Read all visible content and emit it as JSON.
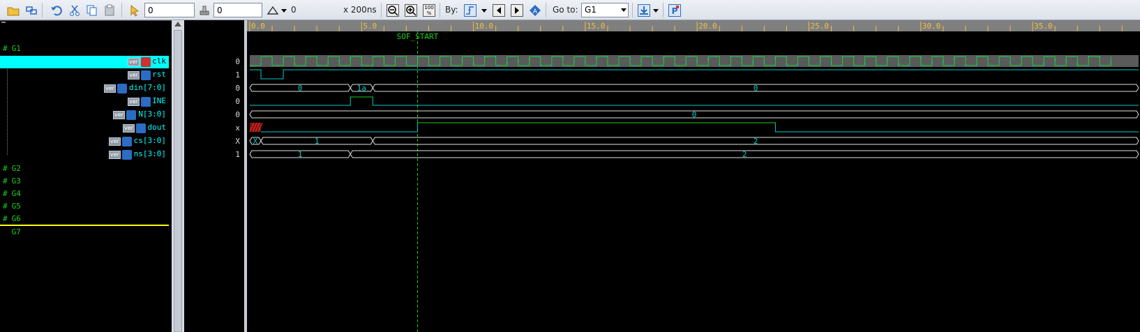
{
  "toolbar": {
    "field1_value": "0",
    "field2_value": "0",
    "delta_value": "0",
    "scale_text": "x 200ns",
    "zoom_fit_text": "100 %",
    "by_label": "By:",
    "goto_label": "Go to:",
    "goto_selected": "G1"
  },
  "groups": [
    "G1",
    "G2",
    "G3",
    "G4",
    "G5",
    "G6",
    "G7"
  ],
  "signals": [
    {
      "name": "clk",
      "ver": "ver",
      "value": "0",
      "selected": true
    },
    {
      "name": "rst",
      "ver": "ver",
      "value": "1"
    },
    {
      "name": "din[7:0]",
      "ver": "ver",
      "value": "0"
    },
    {
      "name": "INE",
      "ver": "ver",
      "value": "0"
    },
    {
      "name": "N[3:0]",
      "ver": "ver",
      "value": "0"
    },
    {
      "name": "dout",
      "ver": "ver",
      "value": "x"
    },
    {
      "name": "cs[3:0]",
      "ver": "ver",
      "value": "X"
    },
    {
      "name": "ns[3:0]",
      "ver": "ver",
      "value": "1"
    }
  ],
  "timeline": {
    "ticks": [
      "0.0",
      "5.0",
      "10.0",
      "15.0",
      "20.0",
      "25.0",
      "30.0",
      "35.0"
    ],
    "tick_values": [
      0,
      5,
      10,
      15,
      20,
      25,
      30,
      35
    ],
    "marker_label": "SOF_START",
    "marker_time": 7.5
  },
  "waves": {
    "din_labels": [
      "0",
      "1a",
      "0"
    ],
    "N_label": "0",
    "cs_labels": [
      "X",
      "1",
      "2"
    ],
    "ns_labels": [
      "1",
      "2"
    ]
  },
  "colors": {
    "grid": "#1bd11b",
    "signal": "#00cccc",
    "bus": "#e0e0e0",
    "selection": "#00ffff",
    "group": "#1bd11b",
    "separator": "#ffff00"
  }
}
